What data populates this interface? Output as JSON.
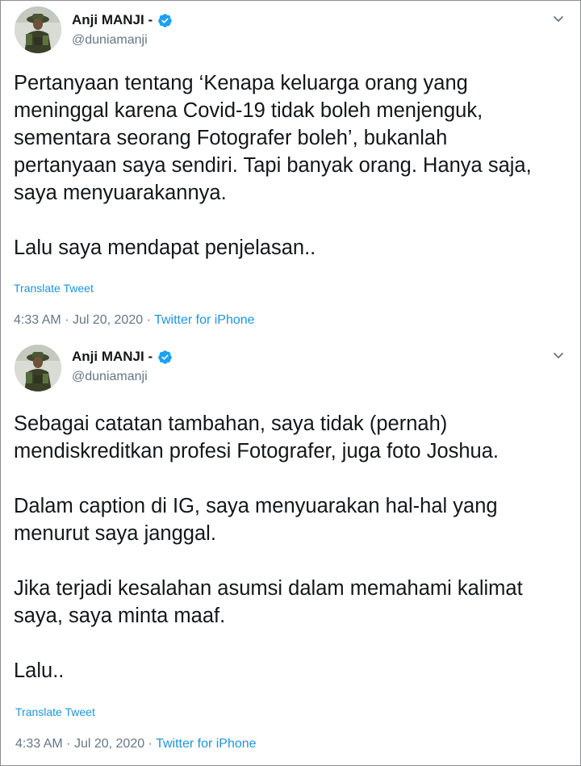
{
  "tweets": [
    {
      "author": {
        "name": "Anji MANJI -",
        "handle": "@duniamanji",
        "verified": true
      },
      "paragraphs": [
        "Pertanyaan tentang ‘Kenapa keluarga orang yang\nmeninggal karena Covid-19 tidak boleh menjenguk,\nsementara seorang Fotografer boleh’, bukanlah\npertanyaan saya sendiri. Tapi banyak orang. Hanya saja,\nsaya menyuarakannya.",
        "Lalu saya mendapat penjelasan.."
      ],
      "translate_label": "Translate Tweet",
      "time": "4:33 AM",
      "date": "Jul 20, 2020",
      "separator": "·",
      "source": "Twitter for iPhone"
    },
    {
      "author": {
        "name": "Anji MANJI -",
        "handle": "@duniamanji",
        "verified": true
      },
      "paragraphs": [
        "Sebagai catatan tambahan, saya tidak (pernah)\nmendiskreditkan profesi Fotografer, juga foto Joshua.",
        "Dalam caption di IG, saya menyuarakan hal-hal yang\nmenurut saya janggal.",
        "Jika terjadi kesalahan asumsi dalam memahami kalimat\nsaya, saya minta maaf.",
        "Lalu.."
      ],
      "translate_label": "Translate Tweet",
      "time": "4:33 AM",
      "date": "Jul 20, 2020",
      "separator": "·",
      "source": "Twitter for iPhone"
    }
  ],
  "colors": {
    "text": "#14171a",
    "secondary": "#657786",
    "link": "#1b95e0",
    "verified_badge": "#1da1f2"
  },
  "icons": {
    "verified": "verified-badge-icon",
    "menu": "chevron-down-icon"
  }
}
